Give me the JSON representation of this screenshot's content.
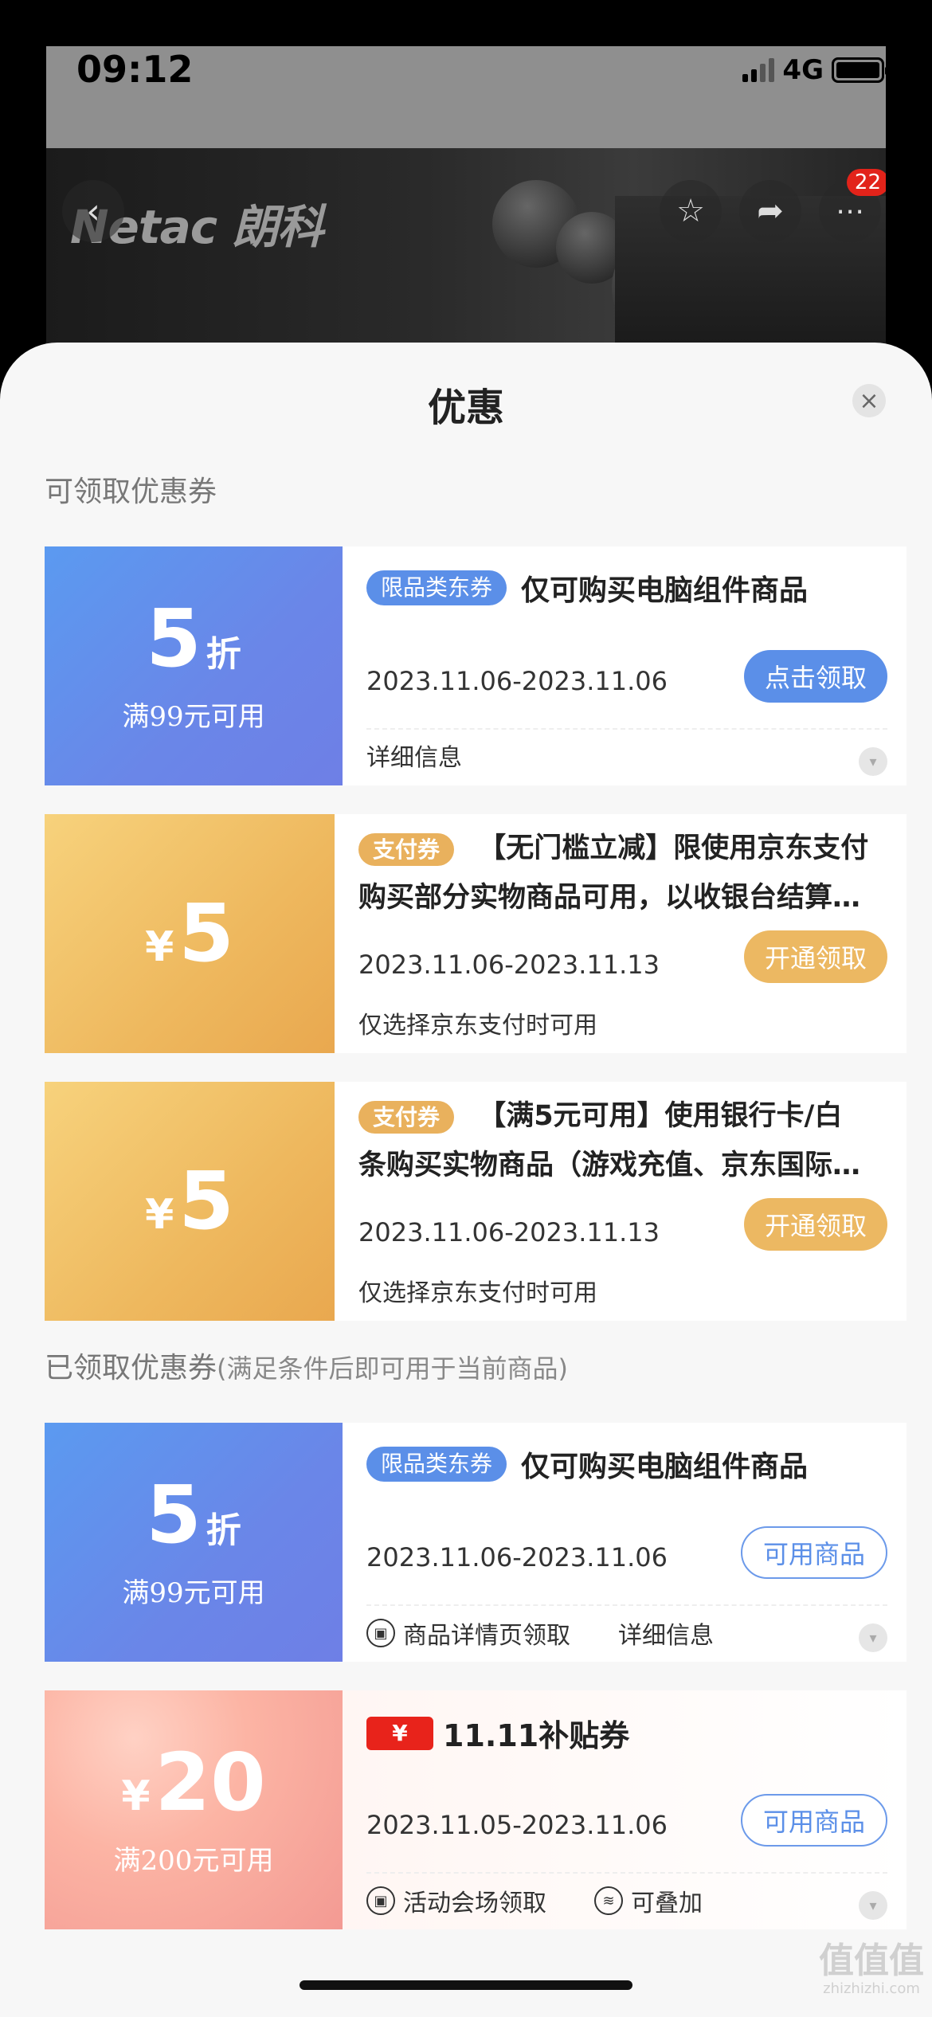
{
  "status_bar": {
    "time": "09:12",
    "network": "4G"
  },
  "background_page": {
    "brand": "Netac 朗科",
    "badge_count": "22"
  },
  "sheet": {
    "title": "优惠",
    "close_icon": "×"
  },
  "sections": {
    "available_label": "可领取优惠券",
    "claimed_label": "已领取优惠券",
    "claimed_sublabel": "(满足条件后即可用于当前商品)"
  },
  "available_coupons": [
    {
      "amount": "5",
      "unit": "折",
      "condition": "满99元可用",
      "tag": "限品类东券",
      "title": "仅可购买电脑组件商品",
      "date": "2023.11.06-2023.11.06",
      "action": "点击领取",
      "footer": "详细信息"
    },
    {
      "amount": "5",
      "unit": "¥",
      "tag": "支付券",
      "title_line1": "【无门槛立减】限使用京东支付",
      "title_line2": "购买部分实物商品可用，以收银台结算…",
      "date": "2023.11.06-2023.11.13",
      "action": "开通领取",
      "footer": "仅选择京东支付时可用"
    },
    {
      "amount": "5",
      "unit": "¥",
      "tag": "支付券",
      "title_line1": "【满5元可用】使用银行卡/白",
      "title_line2": "条购买实物商品（游戏充值、京东国际…",
      "date": "2023.11.06-2023.11.13",
      "action": "开通领取",
      "footer": "仅选择京东支付时可用"
    }
  ],
  "claimed_coupons": [
    {
      "amount": "5",
      "unit": "折",
      "condition": "满99元可用",
      "tag": "限品类东券",
      "title": "仅可购买电脑组件商品",
      "date": "2023.11.06-2023.11.06",
      "action": "可用商品",
      "footer_source": "商品详情页领取",
      "footer_info": "详细信息"
    },
    {
      "amount": "20",
      "unit": "¥",
      "condition": "满200元可用",
      "badge_yen": "¥",
      "badge_text": "11.11补贴券",
      "date": "2023.11.05-2023.11.06",
      "action": "可用商品",
      "footer_source": "活动会场领取",
      "footer_stack": "可叠加"
    }
  ],
  "watermark": {
    "main": "值值值",
    "sub": "zhizhizhi.com"
  },
  "colors": {
    "blue": "#5b8fe8",
    "gold": "#ecb862",
    "red": "#e8231b"
  }
}
